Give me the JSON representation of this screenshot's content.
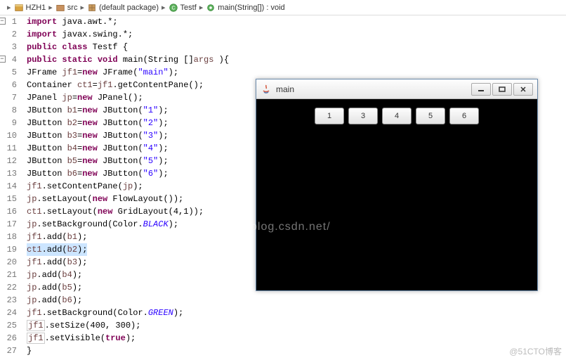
{
  "breadcrumb": {
    "items": [
      "HZH1",
      "src",
      "(default package)",
      "Testf",
      "main(String[]) : void"
    ]
  },
  "code": {
    "lines": [
      {
        "n": 1,
        "tokens": [
          [
            "kw",
            "import"
          ],
          [
            "",
            " java.awt.*;"
          ]
        ],
        "fold": true
      },
      {
        "n": 2,
        "tokens": [
          [
            "kw",
            "import"
          ],
          [
            "",
            " javax.swing.*;"
          ]
        ]
      },
      {
        "n": 3,
        "tokens": [
          [
            "kw",
            "public class"
          ],
          [
            "",
            " Testf {"
          ]
        ]
      },
      {
        "n": 4,
        "tokens": [
          [
            "kw",
            "public static void"
          ],
          [
            "",
            " main(String []"
          ],
          [
            "param",
            "args"
          ],
          [
            "",
            " ){"
          ]
        ],
        "fold": true
      },
      {
        "n": 5,
        "tokens": [
          [
            "",
            "JFrame "
          ],
          [
            "var",
            "jf1"
          ],
          [
            "",
            "="
          ],
          [
            "kw",
            "new"
          ],
          [
            "",
            " JFrame("
          ],
          [
            "str",
            "\"main\""
          ],
          [
            "",
            ");"
          ]
        ]
      },
      {
        "n": 6,
        "tokens": [
          [
            "",
            "Container "
          ],
          [
            "var",
            "ct1"
          ],
          [
            "",
            "="
          ],
          [
            "var",
            "jf1"
          ],
          [
            "",
            ".getContentPane();"
          ]
        ]
      },
      {
        "n": 7,
        "tokens": [
          [
            "",
            "JPanel "
          ],
          [
            "var",
            "jp"
          ],
          [
            "",
            "="
          ],
          [
            "kw",
            "new"
          ],
          [
            "",
            " JPanel();"
          ]
        ]
      },
      {
        "n": 8,
        "tokens": [
          [
            "",
            "JButton "
          ],
          [
            "var",
            "b1"
          ],
          [
            "",
            "="
          ],
          [
            "kw",
            "new"
          ],
          [
            "",
            " JButton("
          ],
          [
            "str",
            "\"1\""
          ],
          [
            "",
            ");"
          ]
        ]
      },
      {
        "n": 9,
        "tokens": [
          [
            "",
            "JButton "
          ],
          [
            "var",
            "b2"
          ],
          [
            "",
            "="
          ],
          [
            "kw",
            "new"
          ],
          [
            "",
            " JButton("
          ],
          [
            "str",
            "\"2\""
          ],
          [
            "",
            ");"
          ]
        ]
      },
      {
        "n": 10,
        "tokens": [
          [
            "",
            "JButton "
          ],
          [
            "var",
            "b3"
          ],
          [
            "",
            "="
          ],
          [
            "kw",
            "new"
          ],
          [
            "",
            " JButton("
          ],
          [
            "str",
            "\"3\""
          ],
          [
            "",
            ");"
          ]
        ]
      },
      {
        "n": 11,
        "tokens": [
          [
            "",
            "JButton "
          ],
          [
            "var",
            "b4"
          ],
          [
            "",
            "="
          ],
          [
            "kw",
            "new"
          ],
          [
            "",
            " JButton("
          ],
          [
            "str",
            "\"4\""
          ],
          [
            "",
            ");"
          ]
        ]
      },
      {
        "n": 12,
        "tokens": [
          [
            "",
            "JButton "
          ],
          [
            "var",
            "b5"
          ],
          [
            "",
            "="
          ],
          [
            "kw",
            "new"
          ],
          [
            "",
            " JButton("
          ],
          [
            "str",
            "\"5\""
          ],
          [
            "",
            ");"
          ]
        ]
      },
      {
        "n": 13,
        "tokens": [
          [
            "",
            "JButton "
          ],
          [
            "var",
            "b6"
          ],
          [
            "",
            "="
          ],
          [
            "kw",
            "new"
          ],
          [
            "",
            " JButton("
          ],
          [
            "str",
            "\"6\""
          ],
          [
            "",
            ");"
          ]
        ]
      },
      {
        "n": 14,
        "tokens": [
          [
            "var",
            "jf1"
          ],
          [
            "",
            ".setContentPane("
          ],
          [
            "var",
            "jp"
          ],
          [
            "",
            ");"
          ]
        ]
      },
      {
        "n": 15,
        "tokens": [
          [
            "var",
            "jp"
          ],
          [
            "",
            ".setLayout("
          ],
          [
            "kw",
            "new"
          ],
          [
            "",
            " FlowLayout());"
          ]
        ]
      },
      {
        "n": 16,
        "tokens": [
          [
            "var",
            "ct1"
          ],
          [
            "",
            ".setLayout("
          ],
          [
            "kw",
            "new"
          ],
          [
            "",
            " GridLayout(4,1));"
          ]
        ]
      },
      {
        "n": 17,
        "tokens": [
          [
            "var",
            "jp"
          ],
          [
            "",
            ".setBackground(Color."
          ],
          [
            "const",
            "BLACK"
          ],
          [
            "",
            ");"
          ]
        ]
      },
      {
        "n": 18,
        "tokens": [
          [
            "var",
            "jf1"
          ],
          [
            "",
            ".add("
          ],
          [
            "var",
            "b1"
          ],
          [
            "",
            ");"
          ]
        ]
      },
      {
        "n": 19,
        "tokens": [
          [
            "var",
            "ct1"
          ],
          [
            "",
            ".add("
          ],
          [
            "var",
            "b2"
          ],
          [
            "",
            ");"
          ]
        ],
        "hl": true
      },
      {
        "n": 20,
        "tokens": [
          [
            "var",
            "jf1"
          ],
          [
            "",
            ".add("
          ],
          [
            "var",
            "b3"
          ],
          [
            "",
            ");"
          ]
        ]
      },
      {
        "n": 21,
        "tokens": [
          [
            "var",
            "jp"
          ],
          [
            "",
            ".add("
          ],
          [
            "var",
            "b4"
          ],
          [
            "",
            ");"
          ]
        ]
      },
      {
        "n": 22,
        "tokens": [
          [
            "var",
            "jp"
          ],
          [
            "",
            ".add("
          ],
          [
            "var",
            "b5"
          ],
          [
            "",
            ");"
          ]
        ]
      },
      {
        "n": 23,
        "tokens": [
          [
            "var",
            "jp"
          ],
          [
            "",
            ".add("
          ],
          [
            "var",
            "b6"
          ],
          [
            "",
            ");"
          ]
        ]
      },
      {
        "n": 24,
        "tokens": [
          [
            "var",
            "jf1"
          ],
          [
            "",
            ".setBackground(Color."
          ],
          [
            "const",
            "GREEN"
          ],
          [
            "",
            ");"
          ]
        ]
      },
      {
        "n": 25,
        "tokens": [
          [
            "box",
            "jf1"
          ],
          [
            "",
            ".setSize(400, 300);"
          ]
        ]
      },
      {
        "n": 26,
        "tokens": [
          [
            "box",
            "jf1"
          ],
          [
            "",
            ".setVisible("
          ],
          [
            "kw",
            "true"
          ],
          [
            "",
            ");"
          ]
        ]
      },
      {
        "n": 27,
        "tokens": [
          [
            "",
            "}"
          ]
        ]
      }
    ]
  },
  "java_window": {
    "title": "main",
    "buttons": [
      "1",
      "3",
      "4",
      "5",
      "6"
    ]
  },
  "watermark": "http://blog.csdn.net/",
  "corner": "@51CTO博客"
}
